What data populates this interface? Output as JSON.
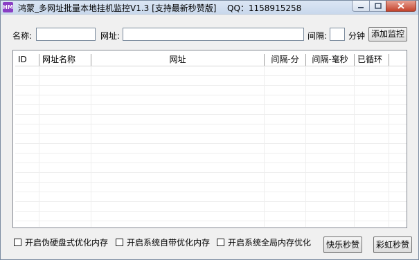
{
  "window": {
    "app_icon_text": "HM",
    "title": "鸿蒙_多网址批量本地挂机监控V1.3 [支持最新秒赞版]",
    "qq": "QQ：1158915258"
  },
  "form": {
    "name_label": "名称:",
    "name_value": "",
    "url_label": "网址:",
    "url_value": "",
    "interval_label": "间隔:",
    "interval_value": "",
    "unit_label": "分钟",
    "add_button": "添加监控"
  },
  "table": {
    "columns": [
      "ID",
      "网址名称",
      "网址",
      "间隔-分",
      "间隔-毫秒",
      "已循环"
    ],
    "rows": []
  },
  "options": [
    {
      "label": "开启伪硬盘式优化内存",
      "checked": false
    },
    {
      "label": "开启系统自带优化内存",
      "checked": false
    },
    {
      "label": "开启系统全局内存优化",
      "checked": false
    }
  ],
  "buttons": {
    "happy": "快乐秒赞",
    "rainbow": "彩虹秒赞"
  }
}
